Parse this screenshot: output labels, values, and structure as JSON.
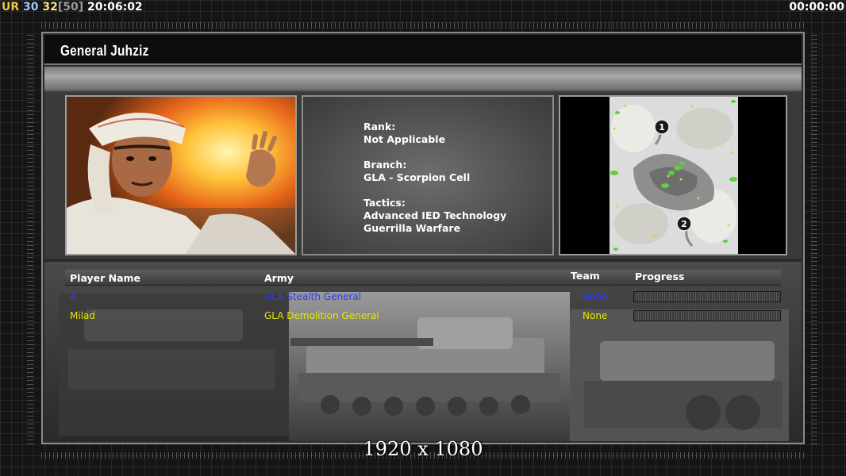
{
  "status_bar": {
    "ur_label": "UR",
    "value_a": "30",
    "value_b": "32",
    "value_c": "[50]",
    "clock": "20:06:02",
    "timer": "00:00:00"
  },
  "title": "General Juhziz",
  "general_info": {
    "rank_label": "Rank:",
    "rank_value": "Not Applicable",
    "branch_label": "Branch:",
    "branch_value": "GLA - Scorpion Cell",
    "tactics_label": "Tactics:",
    "tactics_values": [
      "Advanced IED Technology",
      "Guerrilla Warfare"
    ]
  },
  "minimap": {
    "start_positions": [
      "1",
      "2"
    ]
  },
  "players_table": {
    "headers": {
      "player_name": "Player Name",
      "army": "Army",
      "team": "Team",
      "progress": "Progress"
    },
    "rows": [
      {
        "name": "A",
        "army": "GLA Stealth General",
        "team": "None",
        "color": "#2a3cff",
        "progress": 0
      },
      {
        "name": "Milad",
        "army": "GLA Demolition General",
        "team": "None",
        "color": "#e6e600",
        "progress": 0
      }
    ]
  },
  "resolution_label": "1920 x 1080"
}
